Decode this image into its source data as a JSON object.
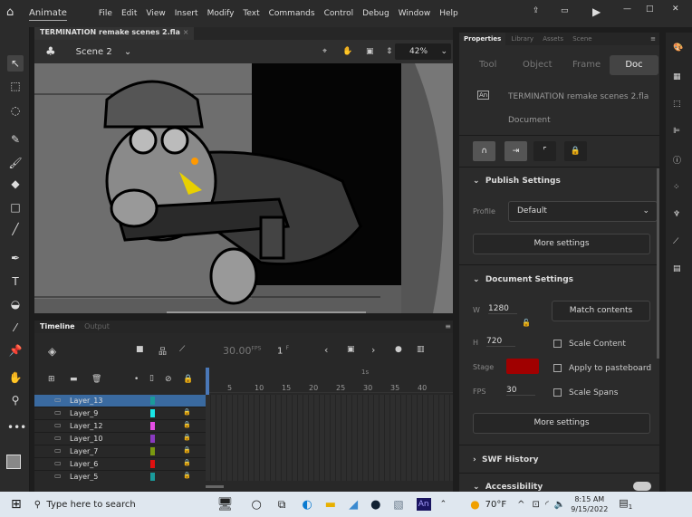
{
  "menubar": {
    "app": "Animate",
    "menus": [
      "File",
      "Edit",
      "View",
      "Insert",
      "Modify",
      "Text",
      "Commands",
      "Control",
      "Debug",
      "Window",
      "Help"
    ]
  },
  "document": {
    "tab": "TERMINATION remake scenes 2.fla",
    "scene": "Scene 2",
    "zoom": "42%"
  },
  "timeline": {
    "tabs": [
      "Timeline",
      "Output"
    ],
    "fps": "30.00",
    "fps_unit": "FPS",
    "frame": "1",
    "frame_unit": "F",
    "ruler_marker": "1s",
    "ruler": [
      "5",
      "10",
      "15",
      "20",
      "25",
      "30",
      "35",
      "40"
    ],
    "layers": [
      {
        "name": "Layer_13",
        "color": "#1a9a9a",
        "locked": false,
        "selected": true
      },
      {
        "name": "Layer_9",
        "color": "#19e6e6",
        "locked": true
      },
      {
        "name": "Layer_12",
        "color": "#e64ee6",
        "locked": true
      },
      {
        "name": "Layer_10",
        "color": "#8a3ac0",
        "locked": true
      },
      {
        "name": "Layer_7",
        "color": "#7a9a10",
        "locked": true
      },
      {
        "name": "Layer_6",
        "color": "#e01010",
        "locked": true
      },
      {
        "name": "Layer_5",
        "color": "#1a9a9a",
        "locked": true
      }
    ]
  },
  "properties": {
    "tabs": [
      "Properties",
      "Library",
      "Assets",
      "Scene"
    ],
    "modes": [
      "Tool",
      "Object",
      "Frame",
      "Doc"
    ],
    "active_mode": "Doc",
    "doc_name": "TERMINATION remake scenes 2.fla",
    "doc_type": "Document",
    "publish": {
      "title": "Publish Settings",
      "profile_label": "Profile",
      "profile": "Default",
      "more": "More settings"
    },
    "docsettings": {
      "title": "Document Settings",
      "w_label": "W",
      "w": "1280",
      "h_label": "H",
      "h": "720",
      "stage_label": "Stage",
      "stage_color": "#a00000",
      "fps_label": "FPS",
      "fps": "30",
      "match": "Match contents",
      "scale_content": "Scale Content",
      "apply_pasteboard": "Apply to pasteboard",
      "scale_spans": "Scale Spans",
      "more": "More settings"
    },
    "swf_history": "SWF History",
    "accessibility": "Accessibility"
  },
  "taskbar": {
    "search": "Type here to search",
    "weather": "70°F",
    "time": "8:15 AM",
    "date": "9/15/2022",
    "notifications": "1"
  }
}
